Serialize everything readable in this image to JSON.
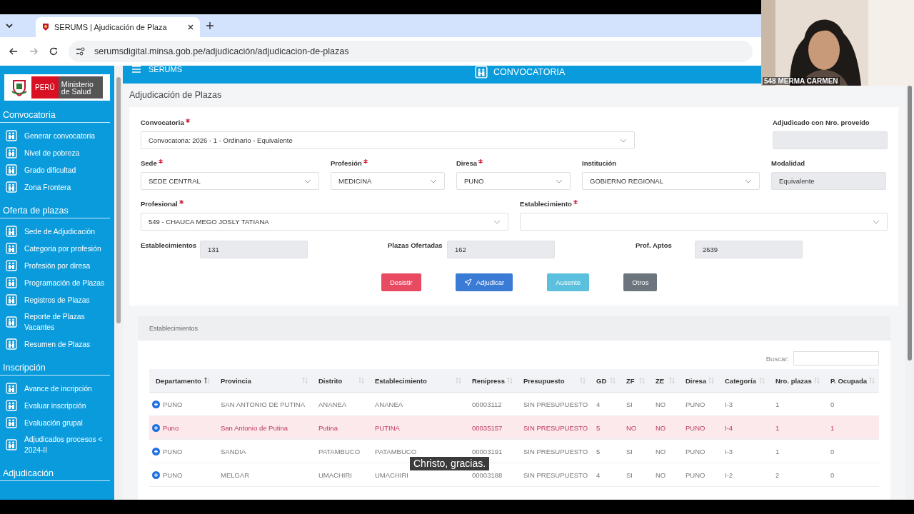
{
  "browser": {
    "tab": {
      "title": "SERUMS | Ajudicación de Plaza"
    },
    "address": "serumsdigital.minsa.gob.pe/adjudicación/adjudicacion-de-plazas"
  },
  "logo": {
    "country": "PERÚ",
    "ministry": "Ministerio de Salud"
  },
  "sidebar": {
    "sections": [
      {
        "title": "Convocatoria",
        "items": [
          "Generar convocatoria",
          "Nivel de pobreza",
          "Grado dificultad",
          "Zona Frontera"
        ]
      },
      {
        "title": "Oferta de plazas",
        "items": [
          "Sede de Adjudicación",
          "Categoria por profesión",
          "Profesión por diresa",
          "Programación de Plazas",
          "Registros de Plazas",
          "Reporte de Plazas Vacantes",
          "Resumen de Plazas"
        ]
      },
      {
        "title": "Inscripción",
        "items": [
          "Avance de incripción",
          "Evaluar inscripción",
          "Evaluación grupal",
          "Adjudicados procesos < 2024-II"
        ]
      },
      {
        "title": "Adjudicación"
      }
    ]
  },
  "header": {
    "app": "SERUMS",
    "section": "CONVOCATORIA"
  },
  "page_title": "Adjudicación de Plazas",
  "form": {
    "fields": [
      {
        "label": "Convocatoria",
        "required": true,
        "kind": "select",
        "value": "Convocatoria: 2026 - 1 - Ordinario - Equivalente"
      },
      {
        "label": "Adjudicado con Nro. proveído",
        "required": false,
        "kind": "readonly"
      },
      {
        "label": "Sede",
        "required": true,
        "kind": "select",
        "value": "SEDE CENTRAL"
      },
      {
        "label": "Profesión",
        "required": true,
        "kind": "select",
        "value": "MEDICINA"
      },
      {
        "label": "Diresa",
        "required": true,
        "kind": "select",
        "value": "PUNO"
      },
      {
        "label": "Institución",
        "required": false,
        "kind": "select",
        "value": "GOBIERNO REGIONAL"
      },
      {
        "label": "Modalidad",
        "required": false,
        "kind": "readonly",
        "value": "Equivalente"
      },
      {
        "label": "Profesional",
        "required": true,
        "kind": "select",
        "value": "549  -  CHAUCA MEGO JOSLY TATIANA"
      },
      {
        "label": "Establecimiento",
        "required": true,
        "kind": "select"
      }
    ],
    "stats": [
      {
        "label": "Establecimientos",
        "value": "131"
      },
      {
        "label": "Plazas Ofertadas",
        "value": "162"
      },
      {
        "label": "Prof. Aptos",
        "value": "2639"
      }
    ],
    "buttons": [
      {
        "label": "Desistir",
        "kind": "danger"
      },
      {
        "label": "Adjudicar",
        "kind": "primary"
      },
      {
        "label": "Ausente",
        "kind": "info"
      },
      {
        "label": "Otros",
        "kind": "secondary"
      }
    ]
  },
  "table": {
    "title": "Establecimientos",
    "search_label": "Buscar:",
    "columns": [
      {
        "label": "Departamento",
        "sorted": true
      },
      {
        "label": "Provincia",
        "sorted": false
      },
      {
        "label": "Distrito",
        "sorted": false
      },
      {
        "label": "Establecimiento",
        "sorted": false
      },
      {
        "label": "Renipress",
        "sorted": false
      },
      {
        "label": "Presupuesto",
        "sorted": false
      },
      {
        "label": "GD",
        "sorted": false
      },
      {
        "label": "ZF",
        "sorted": false
      },
      {
        "label": "ZE",
        "sorted": false
      },
      {
        "label": "Diresa",
        "sorted": false
      },
      {
        "label": "Categoría",
        "sorted": false
      },
      {
        "label": "Nro. plazas",
        "sorted": false
      },
      {
        "label": "P. Ocupada",
        "sorted": false
      }
    ],
    "rows": [
      {
        "highlighted": false,
        "cells": [
          "PUNO",
          "SAN ANTONIO DE PUTINA",
          "ANANEA",
          "ANANEA",
          "00003112",
          "SIN PRESUPUESTO",
          "4",
          "SI",
          "NO",
          "PUNO",
          "I-3",
          "1",
          "0"
        ]
      },
      {
        "highlighted": true,
        "cells": [
          "Puno",
          "San Antonio de Putina",
          "Putina",
          "PUTINA",
          "00035157",
          "SIN PRESUPUESTO",
          "5",
          "NO",
          "NO",
          "PUNO",
          "I-4",
          "1",
          "1"
        ]
      },
      {
        "highlighted": false,
        "cells": [
          "PUNO",
          "SANDIA",
          "PATAMBUCO",
          "PATAMBUCO",
          "00003191",
          "SIN PRESUPUESTO",
          "5",
          "SI",
          "NO",
          "PUNO",
          "I-3",
          "1",
          "0"
        ]
      },
      {
        "highlighted": false,
        "cells": [
          "PUNO",
          "MELGAR",
          "UMACHIRI",
          "UMACHIRI",
          "00003188",
          "SIN PRESUPUESTO",
          "4",
          "SI",
          "NO",
          "PUNO",
          "I-2",
          "2",
          "0"
        ]
      }
    ]
  },
  "video": {
    "name": "548 MERMA CARMEN"
  },
  "caption": "Christo, gracias."
}
